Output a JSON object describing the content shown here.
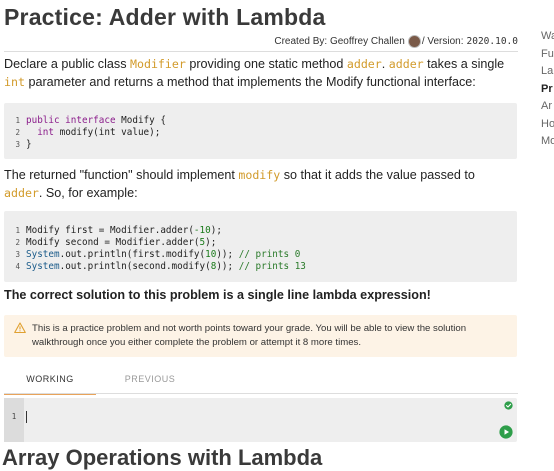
{
  "page": {
    "title": "Practice: Adder with Lambda",
    "byline_prefix": "Created By: Geoffrey Challen",
    "version_label": "/ Version:",
    "version": "2020.10.0"
  },
  "intro": {
    "t1": "Declare a public class ",
    "k1": "Modifier",
    "t2": " providing one static method ",
    "k2": "adder",
    "t3": ". ",
    "k3": "adder",
    "t4": " takes a single ",
    "k4": "int",
    "t5": " parameter and returns a method that implements the Modify functional interface:"
  },
  "code1": {
    "lines": [
      {
        "n": "1",
        "kw": "public interface",
        "rest": " Modify {"
      },
      {
        "n": "2",
        "kw": "  int",
        "rest": " modify(int value);"
      },
      {
        "n": "3",
        "kw": "",
        "rest": "}"
      }
    ]
  },
  "para2": {
    "t1": "The returned \"function\" should implement ",
    "k1": "modify",
    "t2": " so that it adds the value passed to",
    "k2": "adder",
    "t3": ". So, for example:"
  },
  "code2": {
    "l1": {
      "n": "1",
      "a": "Modify first = Modifier.adder(",
      "num": "-10",
      "b": ");"
    },
    "l2": {
      "n": "2",
      "a": "Modify second = Modifier.adder(",
      "num": "5",
      "b": ");"
    },
    "l3": {
      "n": "3",
      "sys": "System",
      "a": ".out.println(first.modify(",
      "num": "10",
      "b": ")); ",
      "cm": "// prints 0"
    },
    "l4": {
      "n": "4",
      "sys": "System",
      "a": ".out.println(second.modify(",
      "num": "8",
      "b": ")); ",
      "cm": "// prints 13"
    }
  },
  "solution_note": "The correct solution to this problem is a single line lambda expression!",
  "warning": "This is a practice problem and not worth points toward your grade. You will be able to view the solution walkthrough once you either complete the problem or attempt it 8 more times.",
  "tabs": [
    "WORKING",
    "PREVIOUS"
  ],
  "editor": {
    "line": "1"
  },
  "next_heading": "Array Operations with Lambda",
  "sidebar": [
    "Wa",
    "Fu",
    "La",
    "Pr",
    "Ar",
    "Ho",
    "Mo"
  ],
  "colors": {
    "accent": "#e8a35a",
    "inline_code": "#d29b2b",
    "success": "#2e9e4a",
    "warning_bg": "#fdf3e6"
  }
}
